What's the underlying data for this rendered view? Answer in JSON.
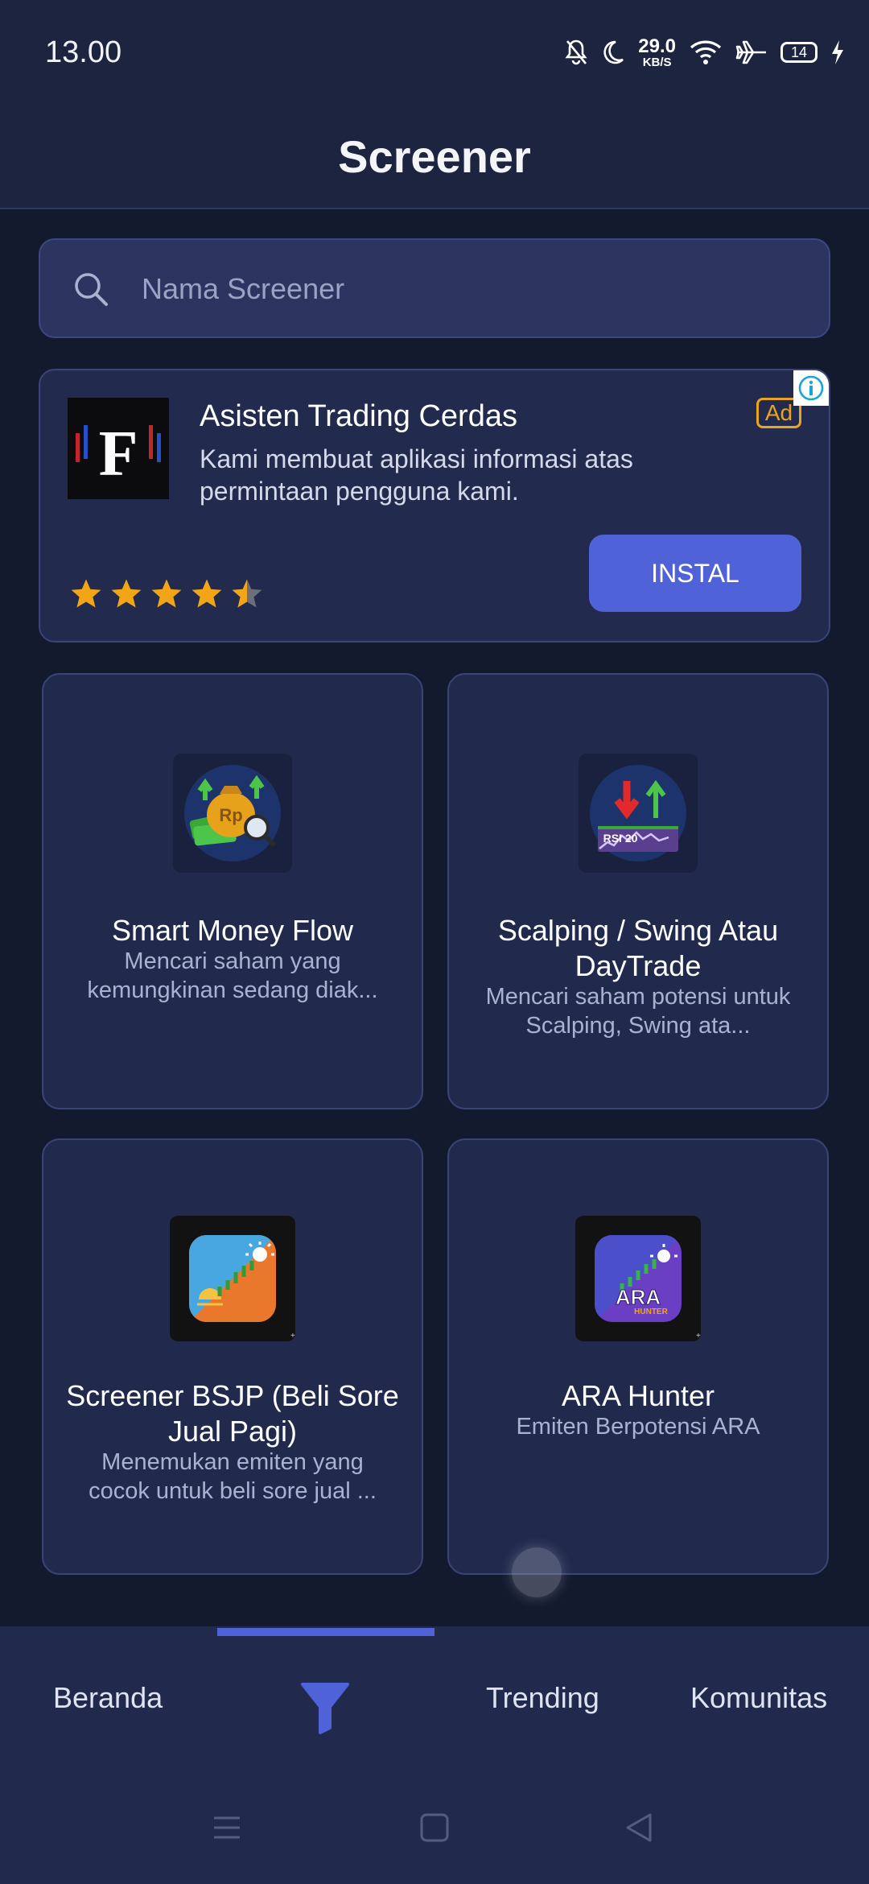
{
  "status": {
    "time": "13.00",
    "net_speed_value": "29.0",
    "net_speed_unit": "KB/S",
    "battery": "14",
    "icons": [
      "bell-off-icon",
      "moon-icon",
      "wifi-icon",
      "airplane-icon",
      "battery-icon",
      "charging-icon"
    ]
  },
  "header": {
    "title": "Screener"
  },
  "search": {
    "placeholder": "Nama Screener",
    "icon": "search-icon"
  },
  "ad": {
    "title": "Asisten Trading Cerdas",
    "description": "Kami membuat aplikasi informasi atas permintaan pengguna kami.",
    "badge": "Ad",
    "install_label": "INSTAL",
    "logo_letter": "F",
    "rating": 4.5,
    "accent": "#4f62d8"
  },
  "screeners": [
    {
      "title": "Smart Money Flow",
      "description": "Mencari saham yang kemungkinan sedang diak...",
      "icon": "money-bag-icon"
    },
    {
      "title": "Scalping / Swing Atau DayTrade",
      "description": "Mencari saham potensi untuk Scalping, Swing ata...",
      "icon": "rsi-chart-icon",
      "icon_text": "RSI 20"
    },
    {
      "title": "Screener BSJP (Beli Sore Jual Pagi)",
      "description": "Menemukan emiten yang cocok untuk beli sore jual ...",
      "icon": "sunset-sunrise-icon"
    },
    {
      "title": "ARA Hunter",
      "description": "Emiten Berpotensi ARA",
      "icon": "ara-hunter-icon",
      "icon_text": "ARA",
      "icon_subtext": "HUNTER"
    }
  ],
  "bottom_nav": {
    "items": [
      {
        "label": "Beranda"
      },
      {
        "label": "",
        "icon": "filter-icon"
      },
      {
        "label": "Trending"
      },
      {
        "label": "Komunitas"
      }
    ],
    "active_color": "#4f62d8"
  },
  "system_nav": [
    "menu-icon",
    "home-square-icon",
    "back-triangle-icon"
  ]
}
